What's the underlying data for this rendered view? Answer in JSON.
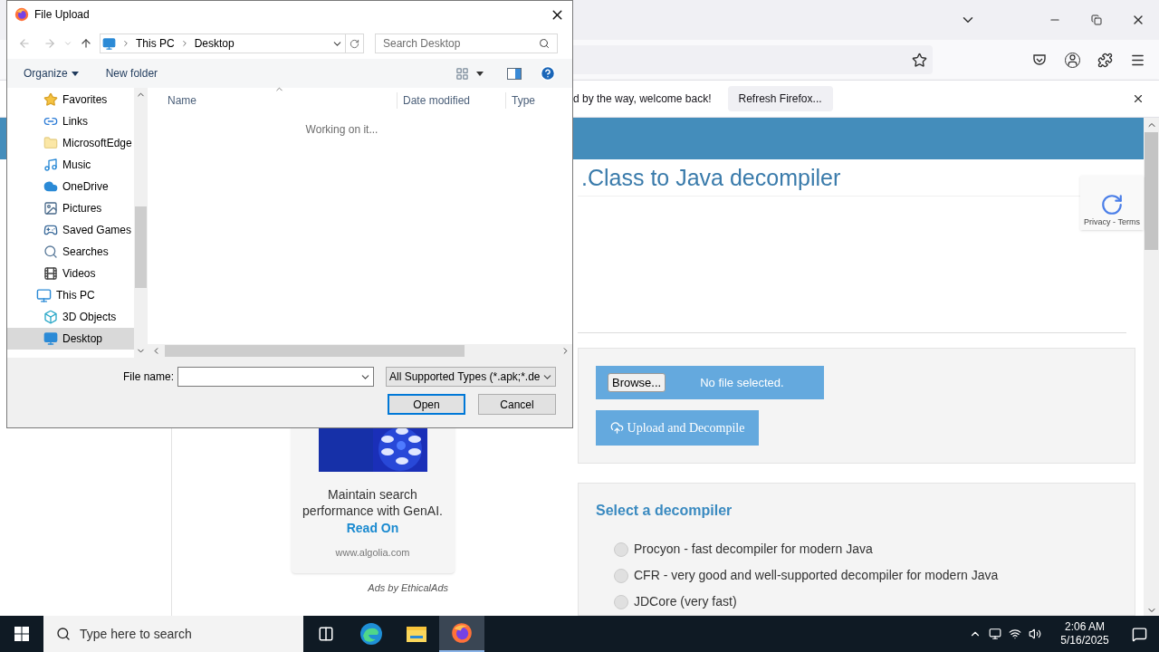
{
  "browser": {
    "notification": {
      "message": "d by the way, welcome back!",
      "button": "Refresh Firefox..."
    }
  },
  "page": {
    "title": ".Class to Java decompiler",
    "ad": {
      "text": "Maintain search performance with GenAI.",
      "link": "Read On",
      "domain": "www.algolia.com",
      "credit": "Ads by EthicalAds"
    },
    "upload": {
      "browse_button": "Browse...",
      "file_status": "No file selected.",
      "submit_button": "Upload and Decompile"
    },
    "decompiler": {
      "heading": "Select a decompiler",
      "options": [
        {
          "label": "Procyon - fast decompiler for modern Java",
          "selected": false
        },
        {
          "label": "CFR - very good and well-supported decompiler for modern Java",
          "selected": false
        },
        {
          "label": "JDCore (very fast)",
          "selected": false
        }
      ]
    },
    "recaptcha": {
      "links": "Privacy - Terms"
    }
  },
  "dialog": {
    "title": "File Upload",
    "breadcrumb": [
      "This PC",
      "Desktop"
    ],
    "search": {
      "placeholder": "Search Desktop"
    },
    "toolbar": [
      "Organize",
      "New folder"
    ],
    "nav_items": [
      {
        "label": "Favorites",
        "kind": "star",
        "selected": false
      },
      {
        "label": "Links",
        "kind": "link",
        "selected": false
      },
      {
        "label": "MicrosoftEdge",
        "kind": "folder",
        "selected": false
      },
      {
        "label": "Music",
        "kind": "music",
        "selected": false
      },
      {
        "label": "OneDrive",
        "kind": "cloud",
        "selected": false
      },
      {
        "label": "Pictures",
        "kind": "pictures",
        "selected": false
      },
      {
        "label": "Saved Games",
        "kind": "games",
        "selected": false
      },
      {
        "label": "Searches",
        "kind": "search",
        "selected": false
      },
      {
        "label": "Videos",
        "kind": "videos",
        "selected": false
      },
      {
        "label": "This PC",
        "kind": "pc",
        "selected": false,
        "children": [
          {
            "label": "3D Objects",
            "kind": "cube",
            "selected": false
          },
          {
            "label": "Desktop",
            "kind": "desktop",
            "selected": true
          }
        ]
      }
    ],
    "columns": [
      "Name",
      "Date modified",
      "Type"
    ],
    "status": "Working on it...",
    "file_name_label": "File name:",
    "file_type": "All Supported Types (*.apk;*.de",
    "buttons": [
      {
        "label": "Open",
        "default": true
      },
      {
        "label": "Cancel",
        "default": false
      }
    ]
  },
  "taskbar": {
    "search_placeholder": "Type here to search",
    "apps": [
      {
        "kind": "taskview",
        "selected": false
      },
      {
        "kind": "edge",
        "selected": false
      },
      {
        "kind": "explorer",
        "selected": false
      },
      {
        "kind": "firefox",
        "selected": true
      }
    ],
    "time": "2:06 AM",
    "date": "5/16/2025"
  }
}
